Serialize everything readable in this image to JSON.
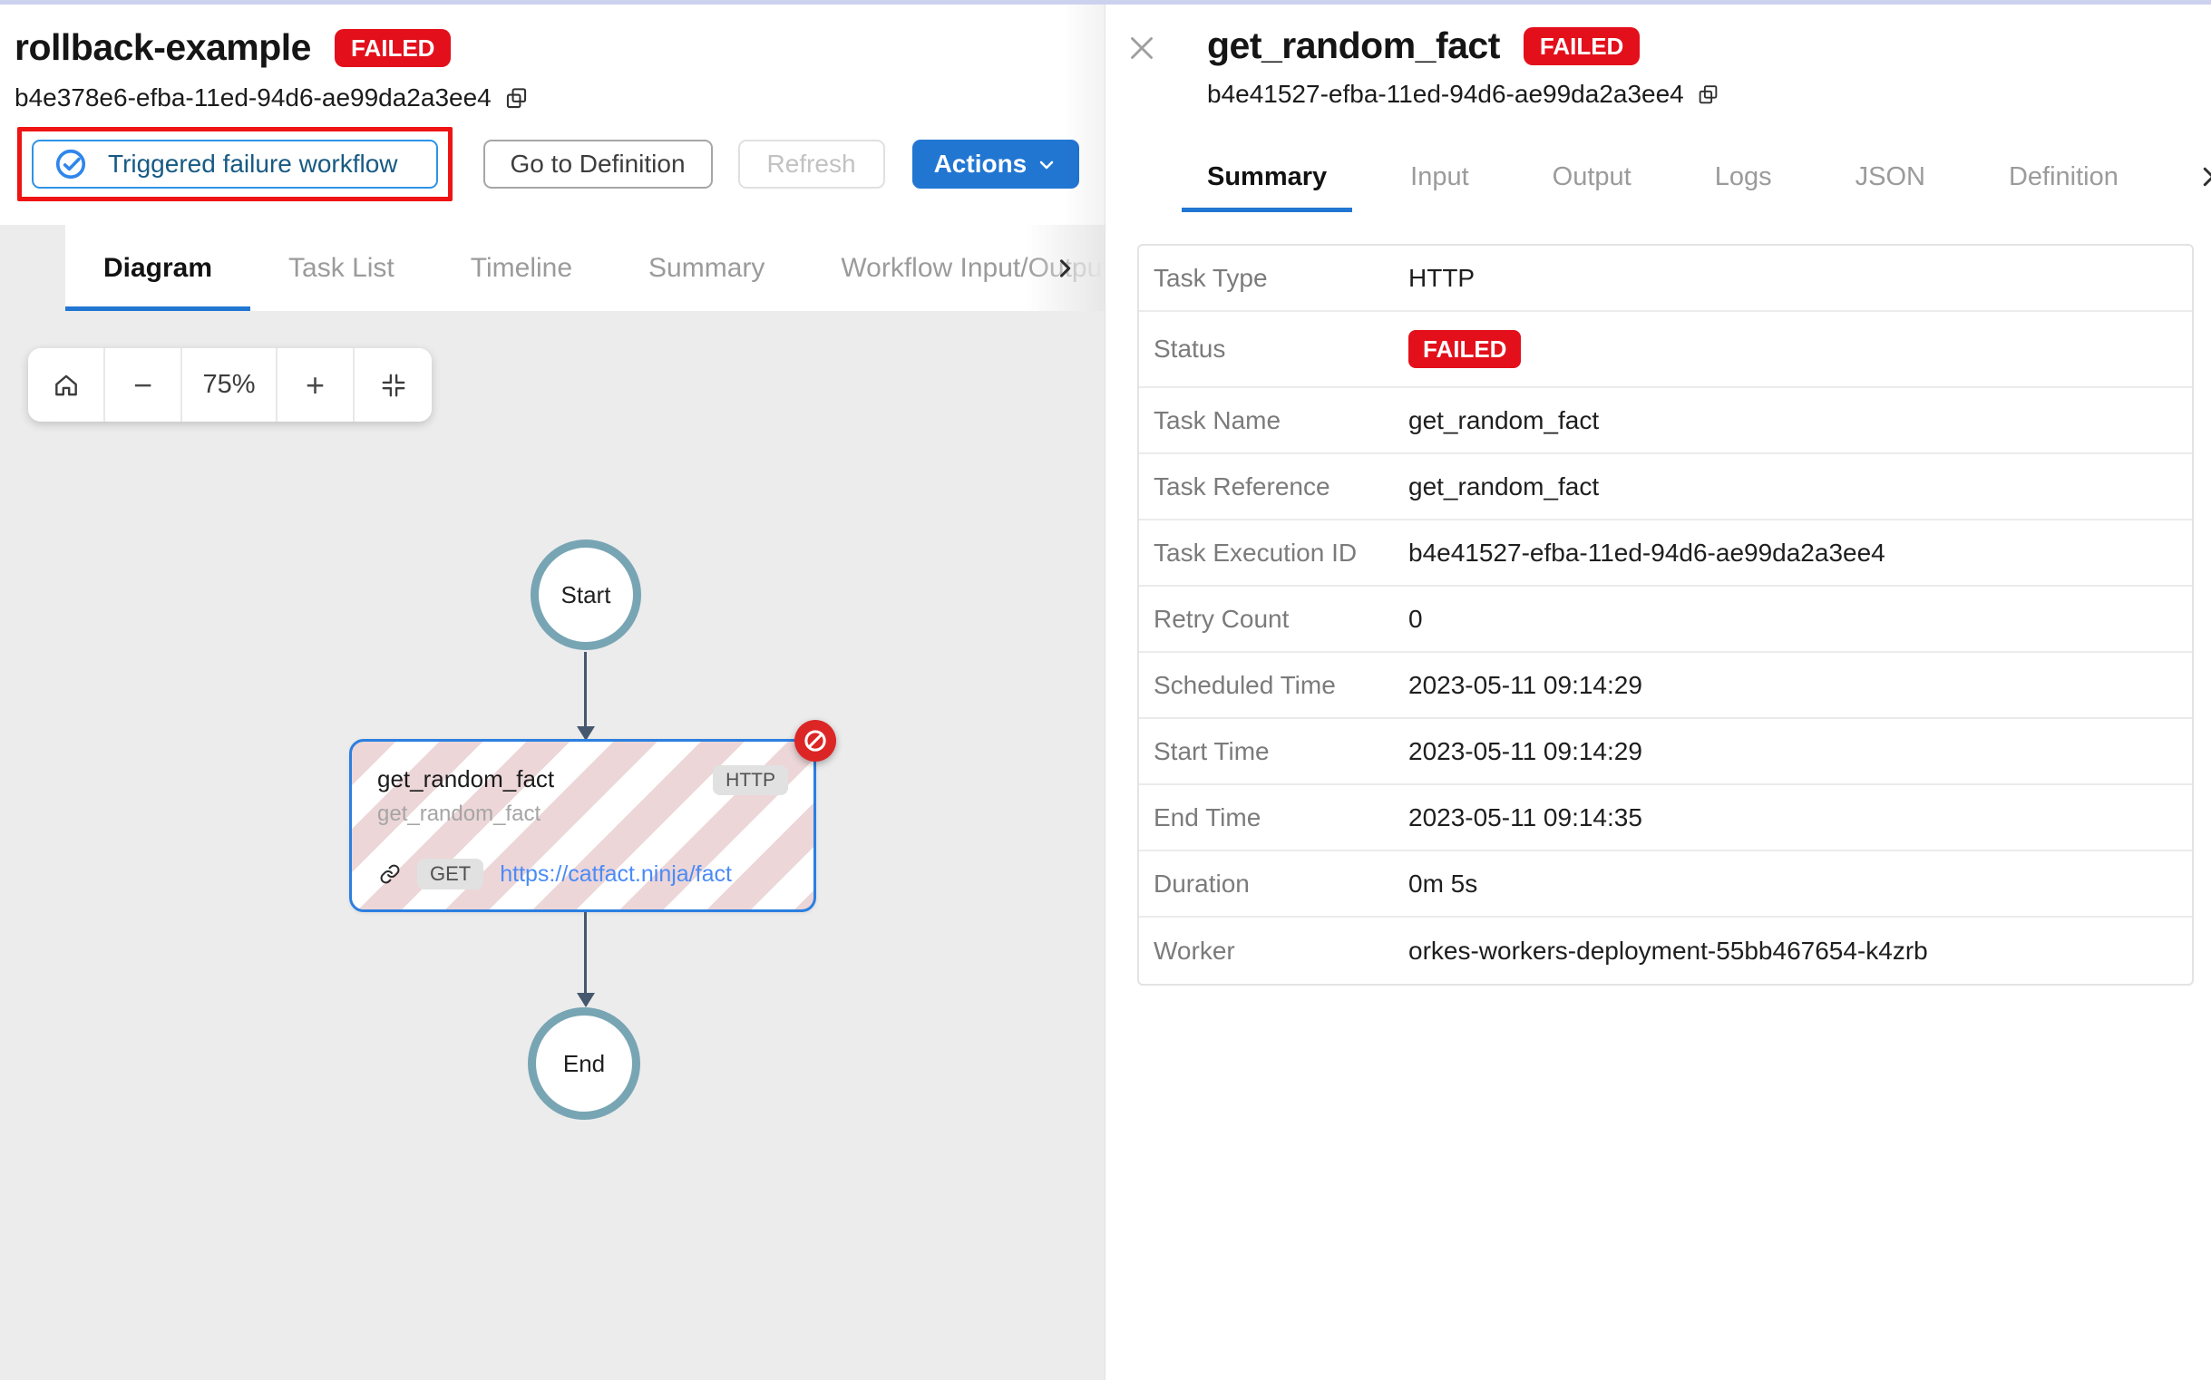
{
  "left": {
    "title": "rollback-example",
    "status_badge": "FAILED",
    "execution_id": "b4e378e6-efba-11ed-94d6-ae99da2a3ee4",
    "buttons": {
      "triggered": "Triggered failure workflow",
      "goto_definition": "Go to Definition",
      "refresh": "Refresh",
      "actions": "Actions"
    },
    "tabs": [
      "Diagram",
      "Task List",
      "Timeline",
      "Summary",
      "Workflow Input/Output"
    ],
    "active_tab": "Diagram",
    "zoom": {
      "level": "75%"
    },
    "diagram": {
      "start_label": "Start",
      "end_label": "End",
      "node": {
        "name": "get_random_fact",
        "ref": "get_random_fact",
        "type_chip": "HTTP",
        "method_chip": "GET",
        "url": "https://catfact.ninja/fact"
      }
    }
  },
  "panel": {
    "title": "get_random_fact",
    "status_badge": "FAILED",
    "execution_id": "b4e41527-efba-11ed-94d6-ae99da2a3ee4",
    "tabs": [
      "Summary",
      "Input",
      "Output",
      "Logs",
      "JSON",
      "Definition"
    ],
    "active_tab": "Summary",
    "summary_rows": [
      {
        "label": "Task Type",
        "value": "HTTP"
      },
      {
        "label": "Status",
        "value": "FAILED"
      },
      {
        "label": "Task Name",
        "value": "get_random_fact"
      },
      {
        "label": "Task Reference",
        "value": "get_random_fact"
      },
      {
        "label": "Task Execution ID",
        "value": "b4e41527-efba-11ed-94d6-ae99da2a3ee4"
      },
      {
        "label": "Retry Count",
        "value": "0"
      },
      {
        "label": "Scheduled Time",
        "value": "2023-05-11 09:14:29"
      },
      {
        "label": "Start Time",
        "value": "2023-05-11 09:14:29"
      },
      {
        "label": "End Time",
        "value": "2023-05-11 09:14:35"
      },
      {
        "label": "Duration",
        "value": "0m 5s"
      },
      {
        "label": "Worker",
        "value": "orkes-workers-deployment-55bb467654-k4zrb"
      }
    ]
  },
  "colors": {
    "accent_blue": "#2176d2",
    "failed_red": "#e3101c",
    "annotation_red": "#ee1414",
    "node_border_blue": "#2b7fe0",
    "terminal_teal": "#78a5b4",
    "link_blue": "#4b8bf5"
  }
}
